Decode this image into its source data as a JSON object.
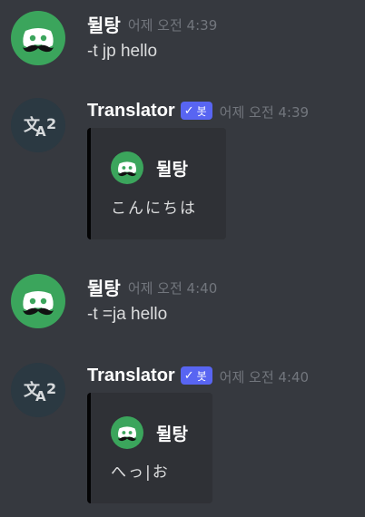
{
  "colors": {
    "background": "#36393f",
    "embed_bg": "#2f3136",
    "bot_tag": "#5865f2",
    "user_avatar": "#3ba55c",
    "bot_avatar": "#2b3942",
    "timestamp": "#72767d"
  },
  "messages": [
    {
      "author": "뒬탕",
      "timestamp": "어제 오전 4:39",
      "content": "-t jp hello",
      "avatar_icon": "discord-mustache-icon"
    },
    {
      "author": "Translator",
      "bot_tag": "봇",
      "timestamp": "어제 오전 4:39",
      "avatar_icon": "translate-icon",
      "embed": {
        "author": "뒬탕",
        "description": "こんにちは"
      }
    },
    {
      "author": "뒬탕",
      "timestamp": "어제 오전 4:40",
      "content": "-t =ja hello",
      "avatar_icon": "discord-mustache-icon"
    },
    {
      "author": "Translator",
      "bot_tag": "봇",
      "timestamp": "어제 오전 4:40",
      "avatar_icon": "translate-icon",
      "embed": {
        "author": "뒬탕",
        "description": "へっ|お"
      }
    }
  ]
}
